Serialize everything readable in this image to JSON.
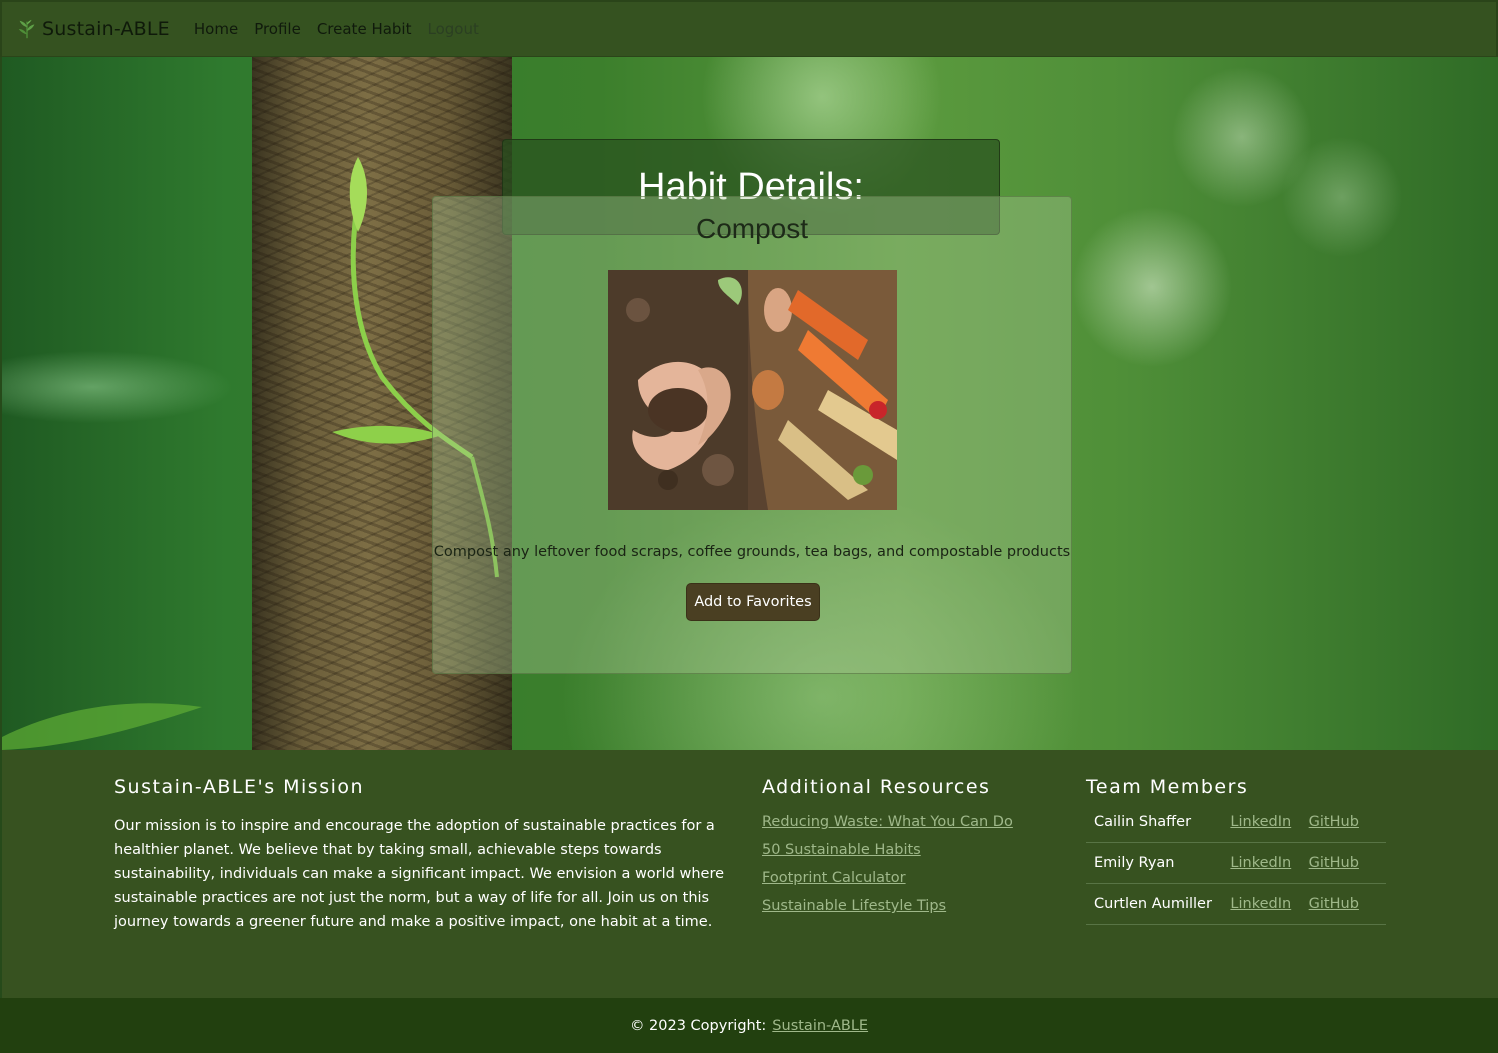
{
  "navbar": {
    "brand": "Sustain-ABLE",
    "links": [
      "Home",
      "Profile",
      "Create Habit",
      "Logout"
    ],
    "icon": "leaf-icon"
  },
  "page": {
    "heading": "Habit Details:"
  },
  "habit": {
    "title": "Compost",
    "image": "compost-photo",
    "description": "Compost any leftover food scraps, coffee grounds, tea bags, and compostable products",
    "button": "Add to Favorites"
  },
  "footer": {
    "mission_heading": "Sustain-ABLE's Mission",
    "mission_text": "Our mission is to inspire and encourage the adoption of sustainable practices for a healthier planet. We believe that by taking small, achievable steps towards sustainability, individuals can make a significant impact. We envision a world where sustainable practices are not just the norm, but a way of life for all. Join us on this journey towards a greener future and make a positive impact, one habit at a time.",
    "resources_heading": "Additional Resources",
    "resources": [
      "Reducing Waste: What You Can Do",
      "50 Sustainable Habits",
      "Footprint Calculator",
      "Sustainable Lifestyle Tips"
    ],
    "team_heading": "Team Members",
    "team": [
      {
        "name": "Cailin Shaffer",
        "linkedin": "LinkedIn",
        "github": "GitHub"
      },
      {
        "name": "Emily Ryan",
        "linkedin": "LinkedIn",
        "github": "GitHub"
      },
      {
        "name": "Curtlen Aumiller",
        "linkedin": "LinkedIn",
        "github": "GitHub"
      }
    ]
  },
  "copyright": {
    "text": "© 2023 Copyright:",
    "link": "Sustain-ABLE"
  },
  "colors": {
    "nav_bg": "#355220",
    "footer_bg": "#375220",
    "copyright_bg": "#22400f",
    "button_bg": "#4a3f22",
    "link": "#9fb88a"
  }
}
